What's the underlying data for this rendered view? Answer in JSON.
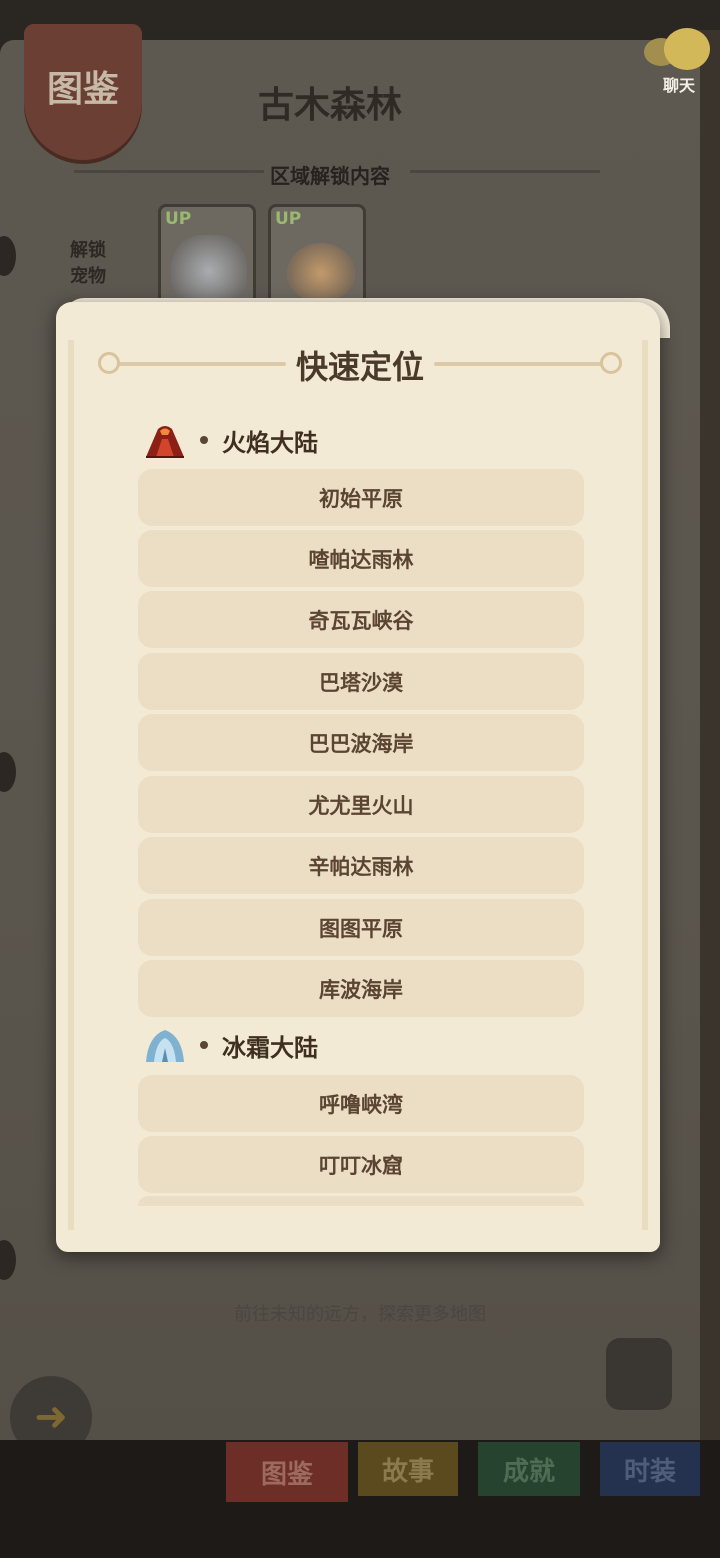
{
  "background": {
    "badge_label": "图鉴",
    "region_title": "古木森林",
    "unlock_title": "区域解锁内容",
    "unlock_pets_label": "解锁\n宠物",
    "pet_cards": [
      {
        "tag": "UP",
        "icon": "heart-icon"
      },
      {
        "tag": "UP",
        "icon": "cluster-icon"
      }
    ],
    "hint": "前往未知的远方，探索更多地图",
    "chat_label": "聊天",
    "bottom_tabs": [
      "图鉴",
      "故事",
      "成就",
      "时装"
    ]
  },
  "modal": {
    "title": "快速定位",
    "sections": [
      {
        "name": "火焰大陆",
        "icon": "volcano-icon",
        "areas": [
          "初始平原",
          "喳帕达雨林",
          "奇瓦瓦峡谷",
          "巴塔沙漠",
          "巴巴波海岸",
          "尤尤里火山",
          "辛帕达雨林",
          "图图平原",
          "库波海岸"
        ]
      },
      {
        "name": "冰霜大陆",
        "icon": "glacier-icon",
        "areas": [
          "呼噜峡湾",
          "叮叮冰窟"
        ]
      }
    ]
  },
  "colors": {
    "parchment": "#f3ead6",
    "button_bg": "#ebdec4",
    "button_text": "#5b4532",
    "title_text": "#4a3a29"
  }
}
